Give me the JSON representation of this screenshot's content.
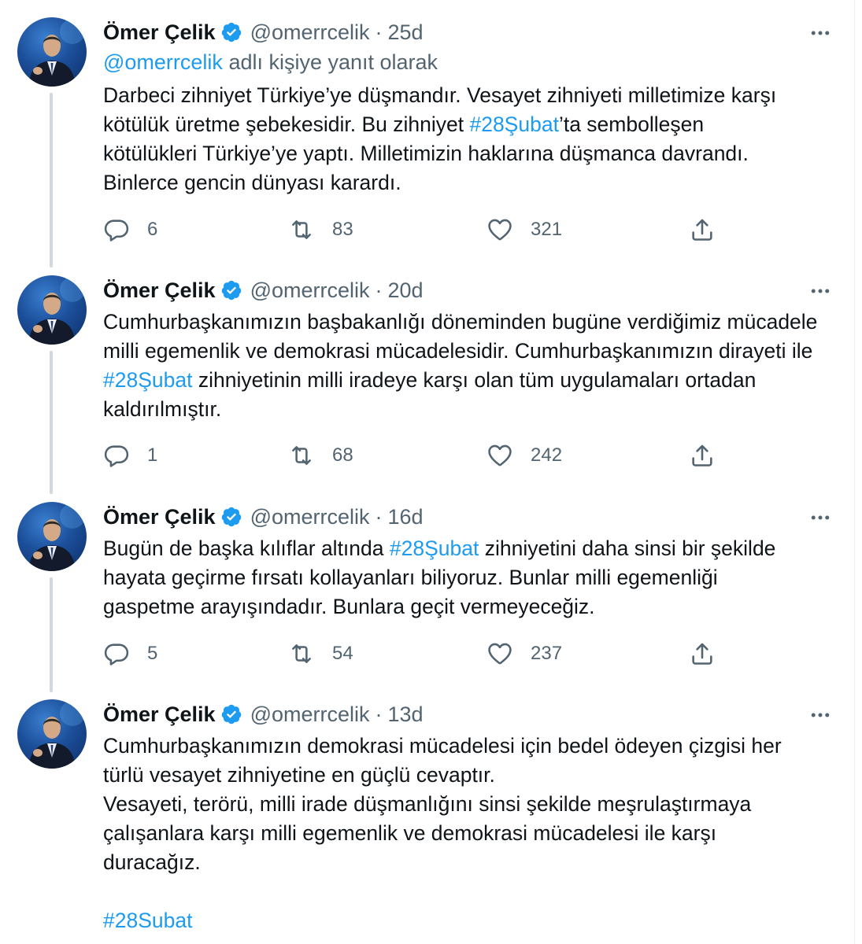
{
  "author": {
    "name": "Ömer Çelik",
    "handle": "@omerrcelik"
  },
  "reply_context": {
    "handle": "@omerrcelik",
    "suffix": " adlı kişiye yanıt olarak"
  },
  "tweets": [
    {
      "time": "25d",
      "lines": [
        [
          {
            "t": "Darbeci zihniyet Türkiye’ye düşmandır. Vesayet zihniyeti milletimize karşı"
          }
        ],
        [
          {
            "t": "kötülük üretme şebekesidir. Bu zihniyet "
          },
          {
            "t": "#28Şubat",
            "link": true
          },
          {
            "t": "’ta sembolleşen"
          }
        ],
        [
          {
            "t": "kötülükleri Türkiye’ye yaptı. Milletimizin haklarına düşmanca davrandı."
          }
        ],
        [
          {
            "t": "Binlerce gencin dünyası karardı."
          }
        ]
      ],
      "replies": "6",
      "retweets": "83",
      "likes": "321"
    },
    {
      "time": "20d",
      "lines": [
        [
          {
            "t": "Cumhurbaşkanımızın başbakanlığı döneminden bugüne verdiğimiz mücadele"
          }
        ],
        [
          {
            "t": "milli egemenlik ve demokrasi mücadelesidir. Cumhurbaşkanımızın dirayeti ile"
          }
        ],
        [
          {
            "t": "#28Şubat",
            "link": true
          },
          {
            "t": " zihniyetinin milli iradeye karşı olan tüm uygulamaları ortadan"
          }
        ],
        [
          {
            "t": "kaldırılmıştır."
          }
        ]
      ],
      "replies": "1",
      "retweets": "68",
      "likes": "242"
    },
    {
      "time": "16d",
      "lines": [
        [
          {
            "t": "Bugün de başka kılıflar altında "
          },
          {
            "t": "#28Şubat",
            "link": true
          },
          {
            "t": " zihniyetini daha sinsi bir şekilde"
          }
        ],
        [
          {
            "t": "hayata geçirme fırsatı kollayanları biliyoruz. Bunlar milli egemenliği"
          }
        ],
        [
          {
            "t": "gaspetme arayışındadır. Bunlara geçit vermeyeceğiz."
          }
        ]
      ],
      "replies": "5",
      "retweets": "54",
      "likes": "237"
    },
    {
      "time": "13d",
      "lines": [
        [
          {
            "t": "Cumhurbaşkanımızın demokrasi mücadelesi için bedel ödeyen çizgisi her"
          }
        ],
        [
          {
            "t": "türlü vesayet zihniyetine en güçlü cevaptır."
          }
        ],
        [
          {
            "t": "Vesayeti, terörü, milli irade düşmanlığını sinsi şekilde meşrulaştırmaya"
          }
        ],
        [
          {
            "t": "çalışanlara karşı milli egemenlik ve demokrasi mücadelesi ile karşı"
          }
        ],
        [
          {
            "t": "duracağız."
          }
        ],
        [
          {
            "t": ""
          }
        ],
        [
          {
            "t": "#28Subat",
            "link": true
          }
        ]
      ]
    }
  ],
  "separator": "·",
  "icons": {
    "verified": "verified-badge-icon",
    "more": "more-icon",
    "reply": "reply-icon",
    "retweet": "retweet-icon",
    "like": "heart-icon",
    "share": "share-icon"
  },
  "colors": {
    "link": "#1d9bf0",
    "secondary_text": "#536471",
    "primary_text": "#0f1419",
    "thread_line": "#cfd9de"
  }
}
